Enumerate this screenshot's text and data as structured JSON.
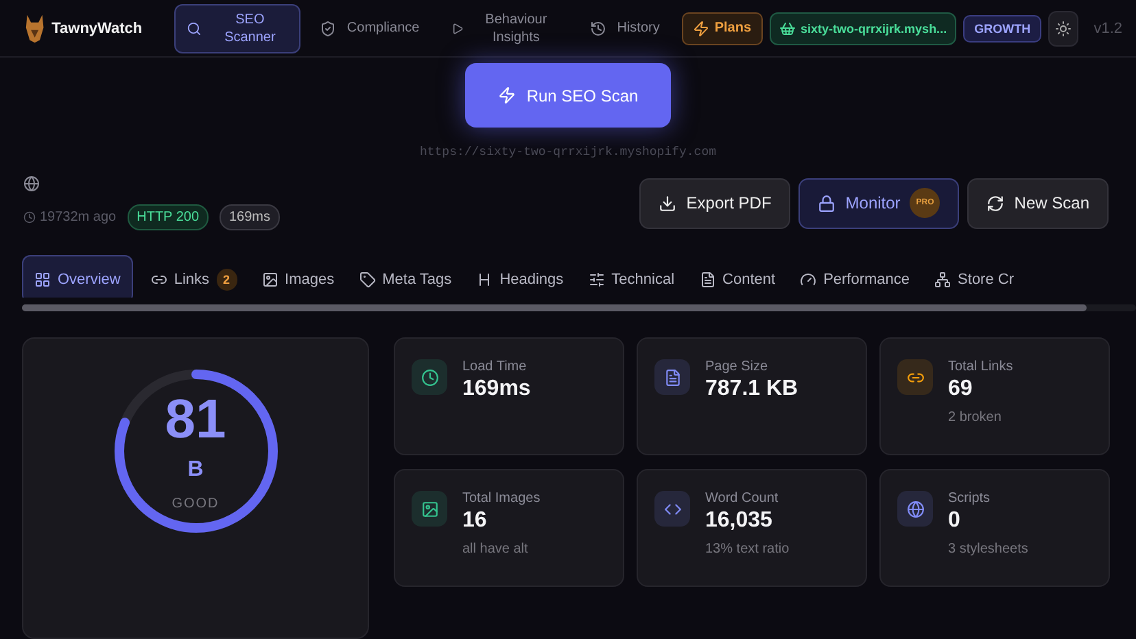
{
  "brand": {
    "name": "TawnyWatch"
  },
  "nav": [
    {
      "label": "SEO Scanner",
      "selected": true
    },
    {
      "label": "Compliance",
      "selected": false
    },
    {
      "label": "Behaviour Insights",
      "selected": false
    },
    {
      "label": "History",
      "selected": false
    }
  ],
  "plans": {
    "label": "Plans"
  },
  "store": {
    "label": "sixty-two-qrrxijrk.mysh..."
  },
  "plan_badge": "GROWTH",
  "version": "v1.2",
  "scan": {
    "button": "Run SEO Scan",
    "url": "https://sixty-two-qrrxijrk.myshopify.com"
  },
  "meta": {
    "age": "19732m ago",
    "status": "HTTP 200",
    "time": "169ms"
  },
  "actions": [
    {
      "label": "Export PDF",
      "kind": "export"
    },
    {
      "label": "Monitor",
      "kind": "pro",
      "badge": "PRO"
    },
    {
      "label": "New Scan",
      "kind": "refresh"
    }
  ],
  "tabs": [
    {
      "label": "Overview",
      "selected": true
    },
    {
      "label": "Links",
      "count": "2",
      "selected": false
    },
    {
      "label": "Images",
      "selected": false
    },
    {
      "label": "Meta Tags",
      "selected": false
    },
    {
      "label": "Headings",
      "selected": false
    },
    {
      "label": "Technical",
      "selected": false
    },
    {
      "label": "Content",
      "selected": false
    },
    {
      "label": "Performance",
      "selected": false
    },
    {
      "label": "Store Cr",
      "selected": false
    }
  ],
  "score": {
    "value": "81",
    "grade": "B",
    "label": "GOOD"
  },
  "stats": [
    {
      "label": "Load Time",
      "value": "169ms",
      "color": "#34c38f"
    },
    {
      "label": "Page Size",
      "value": "787.1 KB",
      "color": "#818cf8"
    },
    {
      "label": "Total Links",
      "value": "69",
      "note": "2 broken",
      "color": "#f59e0b"
    },
    {
      "label": "Total Images",
      "value": "16",
      "note": "all have alt",
      "color": "#34c38f"
    },
    {
      "label": "Word Count",
      "value": "16,035",
      "note": "13% text ratio",
      "color": "#818cf8"
    },
    {
      "label": "Scripts",
      "value": "0",
      "note": "3 stylesheets",
      "color": "#818cf8"
    }
  ]
}
